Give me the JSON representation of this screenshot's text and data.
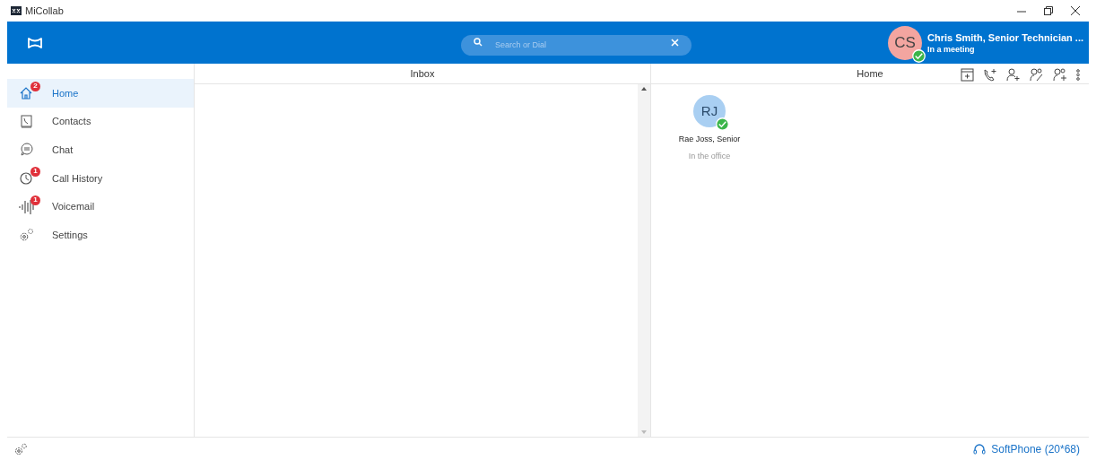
{
  "window": {
    "title": "MiCollab"
  },
  "search": {
    "placeholder": "Search or Dial"
  },
  "user": {
    "initials": "CS",
    "name": "Chris Smith, Senior Technician ...",
    "status": "In a meeting",
    "available": true
  },
  "nav": [
    {
      "kind": "home",
      "label": "Home",
      "badge": "2",
      "selected": true
    },
    {
      "kind": "contacts",
      "label": "Contacts",
      "selected": false
    },
    {
      "kind": "chat",
      "label": "Chat",
      "selected": false
    },
    {
      "kind": "history",
      "label": "Call History",
      "badge": "1",
      "selected": false
    },
    {
      "kind": "voicemail",
      "label": "Voicemail",
      "badge": "1",
      "selected": false
    },
    {
      "kind": "settings",
      "label": "Settings",
      "selected": false
    }
  ],
  "inbox": {
    "title": "Inbox"
  },
  "home": {
    "title": "Home",
    "contacts": [
      {
        "initials": "RJ",
        "name": "Rae Joss, Senior",
        "status": "In the office",
        "available": true
      }
    ]
  },
  "softphone": "SoftPhone (20*68)"
}
